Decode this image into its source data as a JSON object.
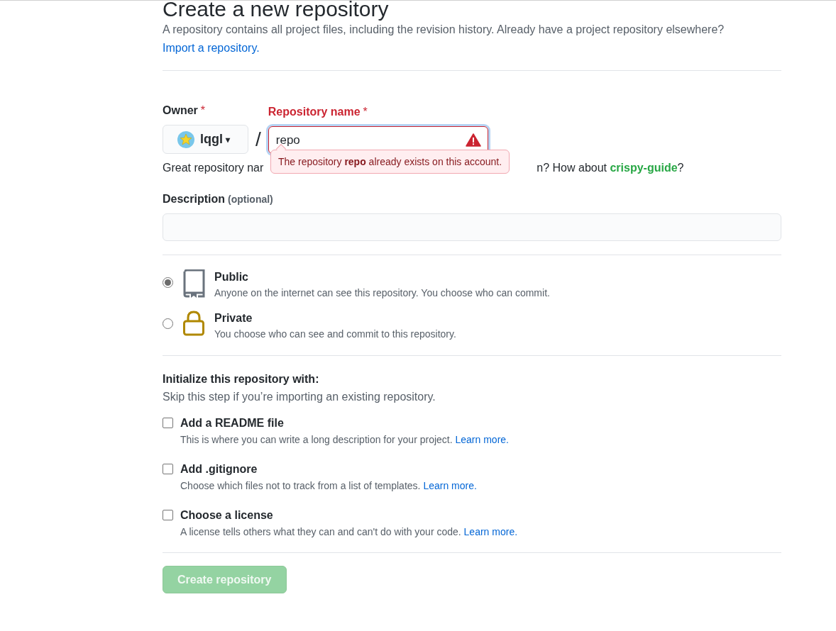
{
  "header": {
    "title": "Create a new repository",
    "description": "A repository contains all project files, including the revision history. Already have a project repository elsewhere?",
    "import_link": "Import a repository."
  },
  "owner": {
    "label": "Owner",
    "required_mark": "*",
    "value": "lqgl",
    "caret": "▾"
  },
  "separator": "/",
  "repository_name": {
    "label": "Repository name",
    "required_mark": "*",
    "value": "repo",
    "invalid": true,
    "error": "The repository **repo** already exists on this account."
  },
  "name_hint": {
    "visible_start": "Great repository nar",
    "visible_end": "n? How about ",
    "suggestion": "crispy-guide",
    "end": "?"
  },
  "description": {
    "label": "Description",
    "optional": "(optional)"
  },
  "visibility": [
    {
      "kind": "public",
      "label": "Public",
      "description": "Anyone on the internet can see this repository. You choose who can commit.",
      "selected": true
    },
    {
      "kind": "private",
      "label": "Private",
      "description": "You choose who can see and commit to this repository.",
      "selected": false
    }
  ],
  "initialize": {
    "title": "Initialize this repository with:",
    "subtitle": "Skip this step if you’re importing an existing repository.",
    "options": [
      {
        "label": "Add a README file",
        "description": "This is where you can write a long description for your project.",
        "link": "Learn more.",
        "checked": false
      },
      {
        "label": "Add .gitignore",
        "description": "Choose which files not to track from a list of templates.",
        "link": "Learn more.",
        "checked": false
      },
      {
        "label": "Choose a license",
        "description": "A license tells others what they can and can't do with your code.",
        "link": "Learn more.",
        "checked": false
      }
    ]
  },
  "submit": {
    "label": "Create repository",
    "disabled": true
  }
}
